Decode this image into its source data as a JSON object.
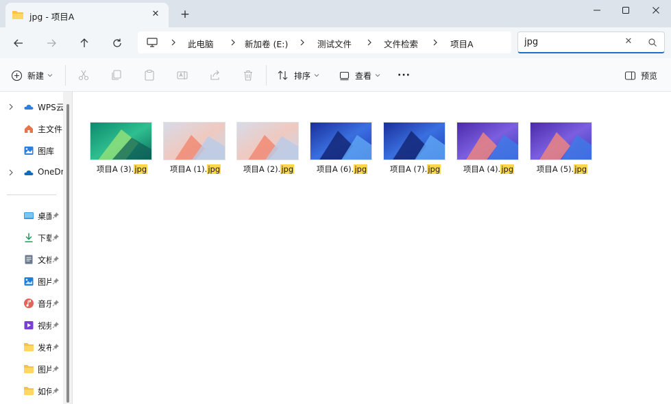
{
  "window": {
    "tab_title": "jpg - 项目A",
    "new_tab_label": "+",
    "close_tab_label": "✕"
  },
  "address": {
    "crumbs": [
      "此电脑",
      "新加卷 (E:)",
      "测试文件",
      "文件检索",
      "项目A"
    ]
  },
  "search": {
    "value": "jpg",
    "clear_label": "✕"
  },
  "toolbar": {
    "new_label": "新建",
    "sort_label": "排序",
    "view_label": "查看",
    "more_label": "···",
    "preview_label": "预览"
  },
  "sidebar": {
    "top_items": [
      {
        "label": "WPS云",
        "icon": "cloud-icon"
      },
      {
        "label": "主文件",
        "icon": "home-icon"
      },
      {
        "label": "图库",
        "icon": "gallery-icon"
      },
      {
        "label": "OneDrive",
        "icon": "onedrive-icon"
      }
    ],
    "pinned_items": [
      {
        "label": "桌面",
        "icon": "desktop-icon"
      },
      {
        "label": "下载",
        "icon": "download-icon"
      },
      {
        "label": "文档",
        "icon": "document-icon"
      },
      {
        "label": "图片",
        "icon": "picture-icon"
      },
      {
        "label": "音乐",
        "icon": "music-icon"
      },
      {
        "label": "视频",
        "icon": "video-icon"
      },
      {
        "label": "发布",
        "icon": "folder-icon"
      },
      {
        "label": "图片",
        "icon": "folder-icon"
      },
      {
        "label": "如何",
        "icon": "folder-icon"
      }
    ]
  },
  "files": [
    {
      "base": "项目A (3).",
      "ext": "jpg",
      "theme": "green"
    },
    {
      "base": "项目A (1).",
      "ext": "jpg",
      "theme": "pastel"
    },
    {
      "base": "项目A (2).",
      "ext": "jpg",
      "theme": "pastel"
    },
    {
      "base": "项目A (6).",
      "ext": "jpg",
      "theme": "blue"
    },
    {
      "base": "项目A (7).",
      "ext": "jpg",
      "theme": "blue"
    },
    {
      "base": "项目A (4).",
      "ext": "jpg",
      "theme": "purple"
    },
    {
      "base": "项目A (5).",
      "ext": "jpg",
      "theme": "purple"
    }
  ],
  "colors": {
    "accent": "#1a6fd1",
    "highlight": "#ffd84a",
    "folder": "#f6c443"
  }
}
